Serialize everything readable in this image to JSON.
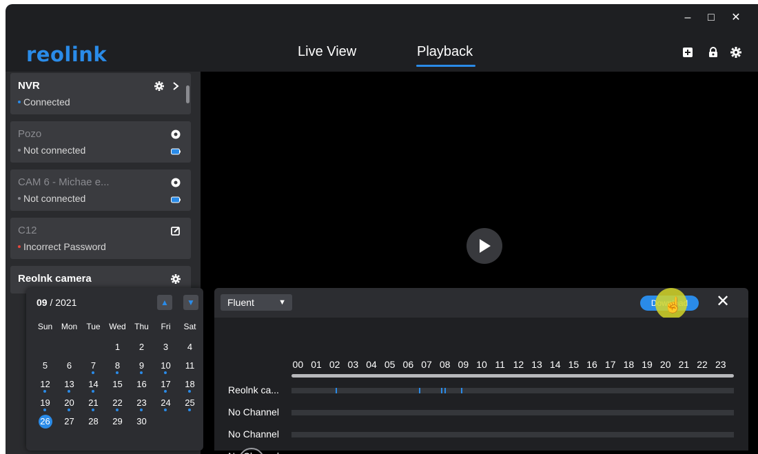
{
  "window": {
    "controls": {
      "minimize": "–",
      "maximize": "□",
      "close": "✕"
    }
  },
  "app": {
    "logo": "reolink",
    "tabs": [
      {
        "label": "Live View",
        "active": false
      },
      {
        "label": "Playback",
        "active": true
      }
    ],
    "header_icons": [
      "add-device-icon",
      "lock-icon",
      "gear-icon"
    ],
    "accent_color": "#2a8be8"
  },
  "devices": [
    {
      "name": "NVR",
      "status": "Connected",
      "status_color": "#2a8be8",
      "icons": [
        "gear-icon",
        "chevron-right-icon"
      ]
    },
    {
      "name": "Pozo",
      "status": "Not connected",
      "status_color": "#8a8b90",
      "icons": [
        "battery-camera-icon",
        "battery-icon"
      ]
    },
    {
      "name": "CAM 6 - Michae e...",
      "status": "Not connected",
      "status_color": "#8a8b90",
      "icons": [
        "battery-camera-icon",
        "battery-icon"
      ]
    },
    {
      "name": "C12",
      "status": "Incorrect Password",
      "status_color": "#e5483d",
      "icons": [
        "edit-icon"
      ]
    },
    {
      "name": "Reolnk camera",
      "icons": [
        "gear-icon"
      ]
    }
  ],
  "calendar": {
    "month": "09",
    "year": "/ 2021",
    "weekdays": [
      "Sun",
      "Mon",
      "Tue",
      "Wed",
      "Thu",
      "Fri",
      "Sat"
    ],
    "weeks": [
      [
        "",
        "",
        "",
        "1",
        "2",
        "3",
        "4"
      ],
      [
        "5",
        "6",
        "7",
        "8",
        "9",
        "10",
        "11"
      ],
      [
        "12",
        "13",
        "14",
        "15",
        "16",
        "17",
        "18"
      ],
      [
        "19",
        "20",
        "21",
        "22",
        "23",
        "24",
        "25"
      ],
      [
        "26",
        "27",
        "28",
        "29",
        "30",
        "",
        ""
      ]
    ],
    "selected_day": "26",
    "days_with_recordings": [
      "7",
      "8",
      "9",
      "10",
      "12",
      "13",
      "14",
      "17",
      "18",
      "19",
      "20",
      "21",
      "22",
      "23",
      "24",
      "25"
    ]
  },
  "playback": {
    "stream_option": "Fluent",
    "download_label": "Download",
    "close_symbol": "✕",
    "hours": [
      "00",
      "01",
      "02",
      "03",
      "04",
      "05",
      "06",
      "07",
      "08",
      "09",
      "10",
      "11",
      "12",
      "13",
      "14",
      "15",
      "16",
      "17",
      "18",
      "19",
      "20",
      "21",
      "22",
      "23"
    ],
    "channels": [
      {
        "name": "Reolnk ca...",
        "recording_hours": [
          2.4,
          6.9,
          8.1,
          8.3,
          9.2
        ]
      },
      {
        "name": "No Channel",
        "recording_hours": []
      },
      {
        "name": "No Channel",
        "recording_hours": []
      },
      {
        "name": "No Channel",
        "recording_hours": []
      }
    ]
  }
}
